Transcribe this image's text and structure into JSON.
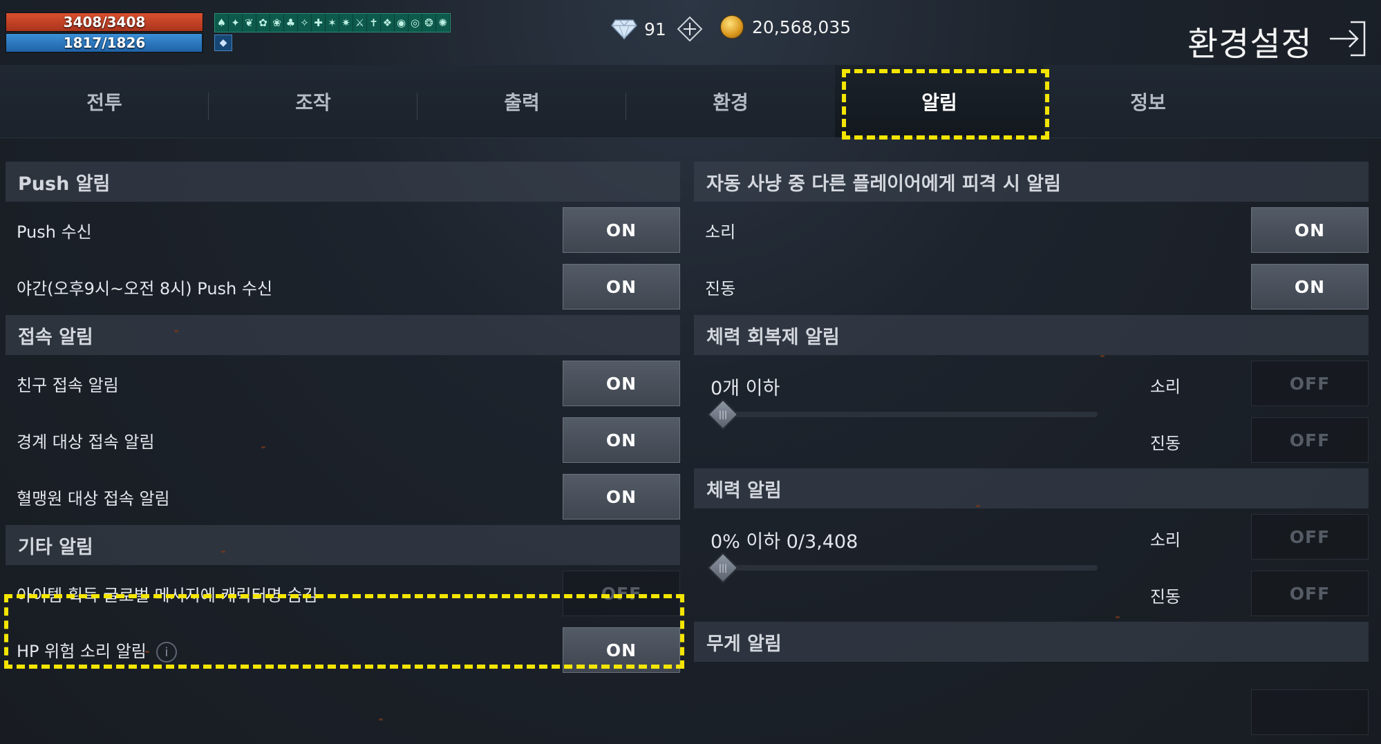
{
  "status": {
    "hp_text": "3408/3408",
    "hp_fraction": 1.0,
    "mp_text": "1817/1826",
    "mp_fraction": 0.995
  },
  "currency": {
    "gems": "91",
    "gold": "20,568,035"
  },
  "header": {
    "title": "환경설정"
  },
  "tabs": [
    {
      "label": "전투"
    },
    {
      "label": "조작"
    },
    {
      "label": "출력"
    },
    {
      "label": "환경"
    },
    {
      "label": "알림"
    },
    {
      "label": "정보"
    }
  ],
  "left": {
    "push": {
      "title": "Push 알림",
      "rows": [
        {
          "label": "Push 수신",
          "state": "ON"
        },
        {
          "label": "야간(오후9시~오전 8시) Push 수신",
          "state": "ON"
        }
      ]
    },
    "connect": {
      "title": "접속 알림",
      "rows": [
        {
          "label": "친구 접속 알림",
          "state": "ON"
        },
        {
          "label": "경계 대상 접속 알림",
          "state": "ON"
        },
        {
          "label": "혈맹원 대상 접속 알림",
          "state": "ON"
        }
      ]
    },
    "etc": {
      "title": "기타 알림",
      "rows": [
        {
          "label": "아이템 획득 글로벌 메시지에 캐릭터명 숨김",
          "state": "OFF"
        },
        {
          "label": "HP 위험 소리 알림",
          "state": "ON"
        }
      ]
    }
  },
  "right": {
    "attacked": {
      "title": "자동 사냥 중 다른 플레이어에게 피격 시 알림",
      "rows": [
        {
          "label": "소리",
          "state": "ON"
        },
        {
          "label": "진동",
          "state": "ON"
        }
      ]
    },
    "potion": {
      "title": "체력 회복제 알림",
      "slider_label": "0개 이하",
      "slider_value": 0,
      "sound_label": "소리",
      "sound_state": "OFF",
      "vibe_label": "진동",
      "vibe_state": "OFF"
    },
    "hp": {
      "title": "체력 알림",
      "slider_label": "0% 이하 0/3,408",
      "slider_value": 0,
      "sound_label": "소리",
      "sound_state": "OFF",
      "vibe_label": "진동",
      "vibe_state": "OFF"
    },
    "weight": {
      "title": "무게 알림"
    }
  },
  "colors": {
    "highlight": "#f3e500",
    "hp": "#c0401f",
    "mp": "#2d7cc4"
  }
}
